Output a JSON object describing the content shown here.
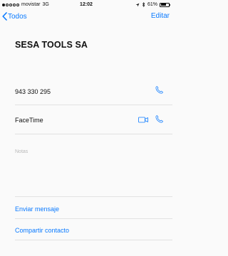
{
  "status_bar": {
    "carrier": "movistar",
    "network": "3G",
    "time": "12:02",
    "battery": "61%",
    "signal_bars": 1,
    "signal_total": 5,
    "battery_level": 0.61
  },
  "nav": {
    "back_label": "Todos",
    "edit_label": "Editar"
  },
  "contact": {
    "name": "SESA TOOLS SA",
    "phone": "943 330 295",
    "facetime_label": "FaceTime",
    "notes_placeholder": "Notas"
  },
  "actions": {
    "send_message": "Enviar mensaje",
    "share_contact": "Compartir contacto"
  },
  "colors": {
    "accent": "#0a7aff",
    "background": "#fafafa"
  }
}
